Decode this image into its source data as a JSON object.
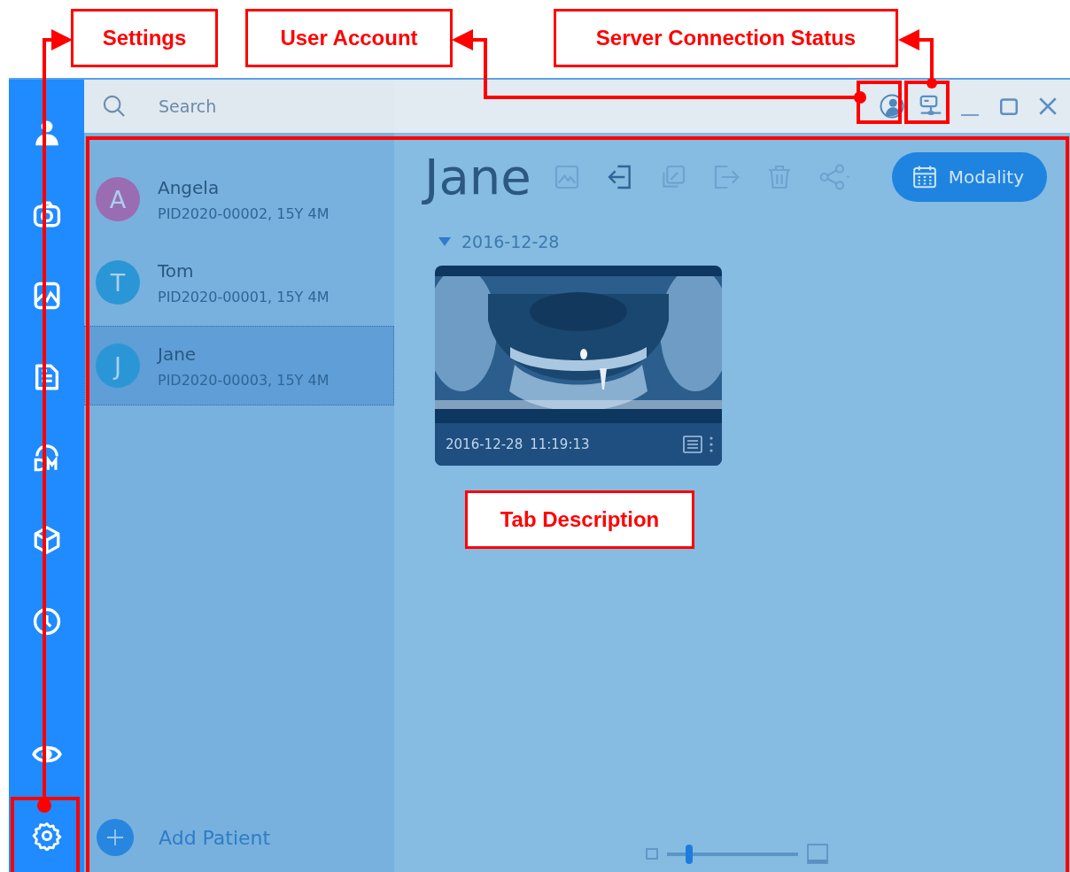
{
  "callouts": [
    {
      "label": "Settings"
    },
    {
      "label": "User Account"
    },
    {
      "label": "Server Connection Status"
    },
    {
      "label": "Tab Description"
    }
  ],
  "search": {
    "placeholder": "Search"
  },
  "patients": [
    {
      "initial": "A",
      "name": "Angela",
      "info": "PID2020-00002, 15Y 4M",
      "color": "#9a6db3",
      "selected": false
    },
    {
      "initial": "T",
      "name": "Tom",
      "info": "PID2020-00001, 15Y 4M",
      "color": "#2b96d6",
      "selected": false
    },
    {
      "initial": "J",
      "name": "Jane",
      "info": "PID2020-00003, 15Y 4M",
      "color": "#2b96d6",
      "selected": true
    }
  ],
  "add_patient": "Add Patient",
  "main": {
    "title": "Jane",
    "modality_button": "Modality",
    "group": {
      "date": "2016-12-28",
      "expanded": true,
      "studies": [
        {
          "kind": "picture",
          "date": "2016-12-28",
          "time": "11:19:13"
        }
      ]
    }
  },
  "zoom_slider": {
    "level": 0.15
  }
}
